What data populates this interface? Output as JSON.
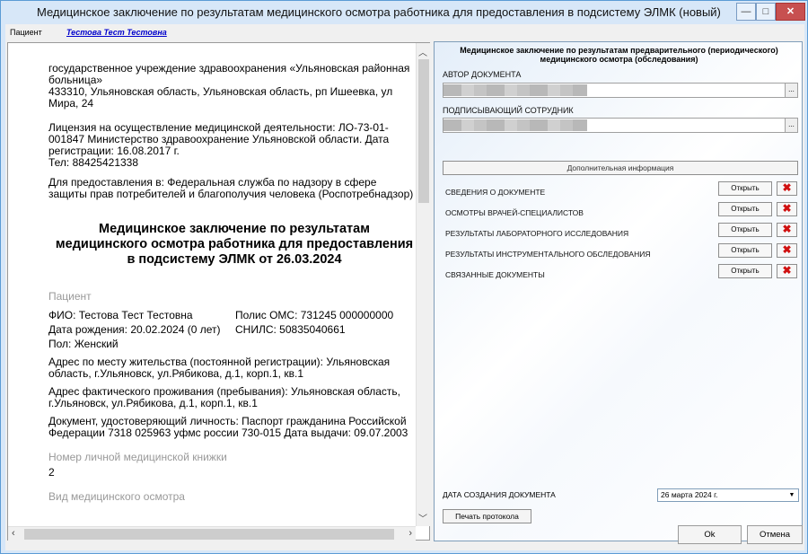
{
  "window": {
    "title": "Медицинское заключение по результатам медицинского осмотра работника для предоставления в подсистему ЭЛМК (новый)",
    "min_glyph": "—",
    "max_glyph": "□",
    "close_glyph": "✕"
  },
  "patientbar": {
    "label": "Пациент",
    "patient_name": "Тестова Тест Тестовна"
  },
  "document": {
    "org_name": "государственное учреждение здравоохранения «Ульяновская районная больница»",
    "org_address": "433310, Ульяновская область, Ульяновская область, рп Ишеевка, ул Мира, 24",
    "license": "Лицензия на осуществление медицинской деятельности: ЛО-73-01-001847 Министерство здравоохранение Ульяновской области. Дата регистрации: 16.08.2017 г.",
    "phone": "Тел: 88425421338",
    "recipient": "Для предоставления в: Федеральная служба по надзору в сфере защиты прав потребителей и благополучия человека (Роспотребнадзор)",
    "heading": "Медицинское заключение по результатам медицинского осмотра работника для предоставления в подсистему ЭЛМК от 26.03.2024",
    "patient_section": "Пациент",
    "fio": "ФИО: Тестова Тест Тестовна",
    "oms": "Полис ОМС: 731245 000000000",
    "dob": "Дата рождения: 20.02.2024 (0 лет)",
    "snils": "СНИЛС: 50835040661",
    "sex": "Пол: Женский",
    "reg_address": "Адрес по месту жительства (постоянной регистрации): Ульяновская область, г.Ульяновск, ул.Рябикова, д.1, корп.1, кв.1",
    "fact_address": "Адрес фактического проживания (пребывания): Ульяновская область, г.Ульяновск, ул.Рябикова, д.1, корп.1, кв.1",
    "id_doc": "Документ, удостоверяющий личность: Паспорт гражданина Российской Федерации 7318 025963 уфмс россии 730-015 Дата выдачи: 09.07.2003",
    "med_book_label": "Номер личной медицинской книжки",
    "med_book_value": "2",
    "exam_type_label": "Вид медицинского осмотра"
  },
  "form": {
    "title": "Медицинское заключение по результатам предварительного (периодического) медицинского осмотра (обследования)",
    "author_label": "АВТОР ДОКУМЕНТА",
    "signer_label": "ПОДПИСЫВАЮЩИЙ СОТРУДНИК",
    "ellipsis": "...",
    "additional_info": "Дополнительная информация",
    "sections": [
      {
        "label": "СВЕДЕНИЯ О ДОКУМЕНТЕ",
        "open": "Открыть"
      },
      {
        "label": "ОСМОТРЫ ВРАЧЕЙ-СПЕЦИАЛИСТОВ",
        "open": "Открыть"
      },
      {
        "label": "РЕЗУЛЬТАТЫ ЛАБОРАТОРНОГО ИССЛЕДОВАНИЯ",
        "open": "Открыть"
      },
      {
        "label": "РЕЗУЛЬТАТЫ ИНСТРУМЕНТАЛЬНОГО ОБСЛЕДОВАНИЯ",
        "open": "Открыть"
      },
      {
        "label": "СВЯЗАННЫЕ ДОКУМЕНТЫ",
        "open": "Открыть"
      }
    ],
    "delete_glyph": "✖",
    "date_label": "ДАТА СОЗДАНИЯ ДОКУМЕНТА",
    "date_value": "26   марта   2024 г.",
    "print_button": "Печать протокола"
  },
  "footer": {
    "ok": "Ok",
    "cancel": "Отмена"
  }
}
